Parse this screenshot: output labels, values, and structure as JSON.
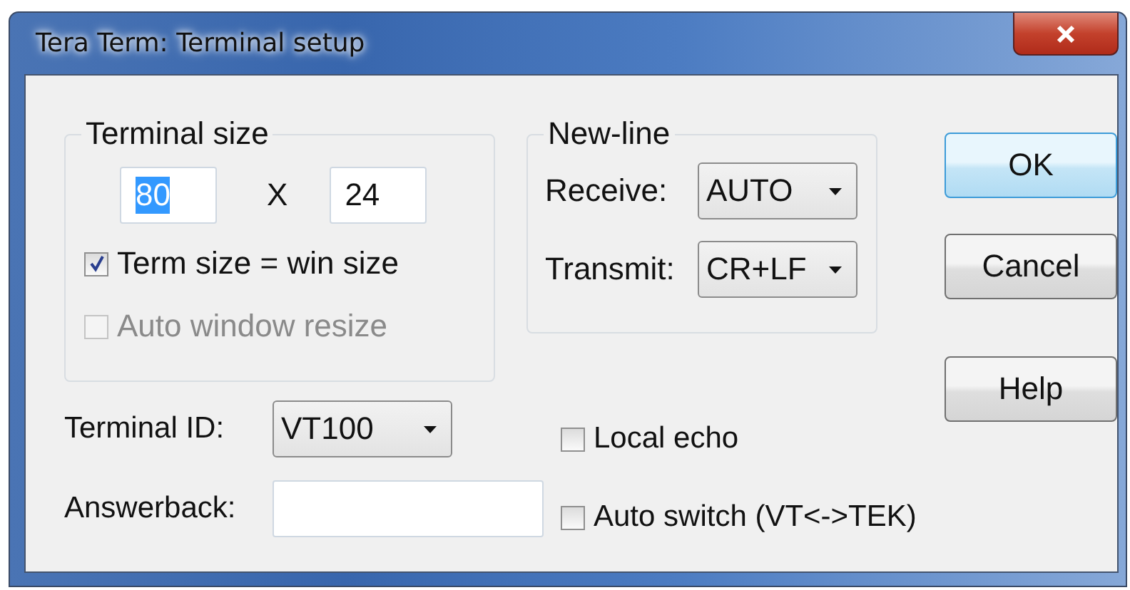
{
  "window": {
    "title": "Tera Term: Terminal setup"
  },
  "terminal_size": {
    "label": "Terminal size",
    "columns": {
      "value": "80",
      "selected": true
    },
    "separator": "X",
    "rows": {
      "value": "24",
      "selected": false
    },
    "options": [
      {
        "label": "Term size = win size",
        "checked": true,
        "disabled": false
      },
      {
        "label": "Auto window resize",
        "checked": false,
        "disabled": true
      }
    ]
  },
  "new_line": {
    "label": "New-line",
    "fields": [
      {
        "label": "Receive:",
        "value": "AUTO"
      },
      {
        "label": "Transmit:",
        "value": "CR+LF"
      }
    ]
  },
  "terminal_id": {
    "label": "Terminal ID:",
    "value": "VT100"
  },
  "answerback": {
    "label": "Answerback:"
  },
  "checkboxes": [
    {
      "label": "Local echo",
      "checked": false,
      "disabled": false
    },
    {
      "label": "Auto switch (VT<->TEK)",
      "checked": false,
      "disabled": false
    }
  ],
  "buttons": [
    {
      "label": "OK",
      "default": true
    },
    {
      "label": "Cancel",
      "default": false
    },
    {
      "label": "Help",
      "default": false
    }
  ]
}
